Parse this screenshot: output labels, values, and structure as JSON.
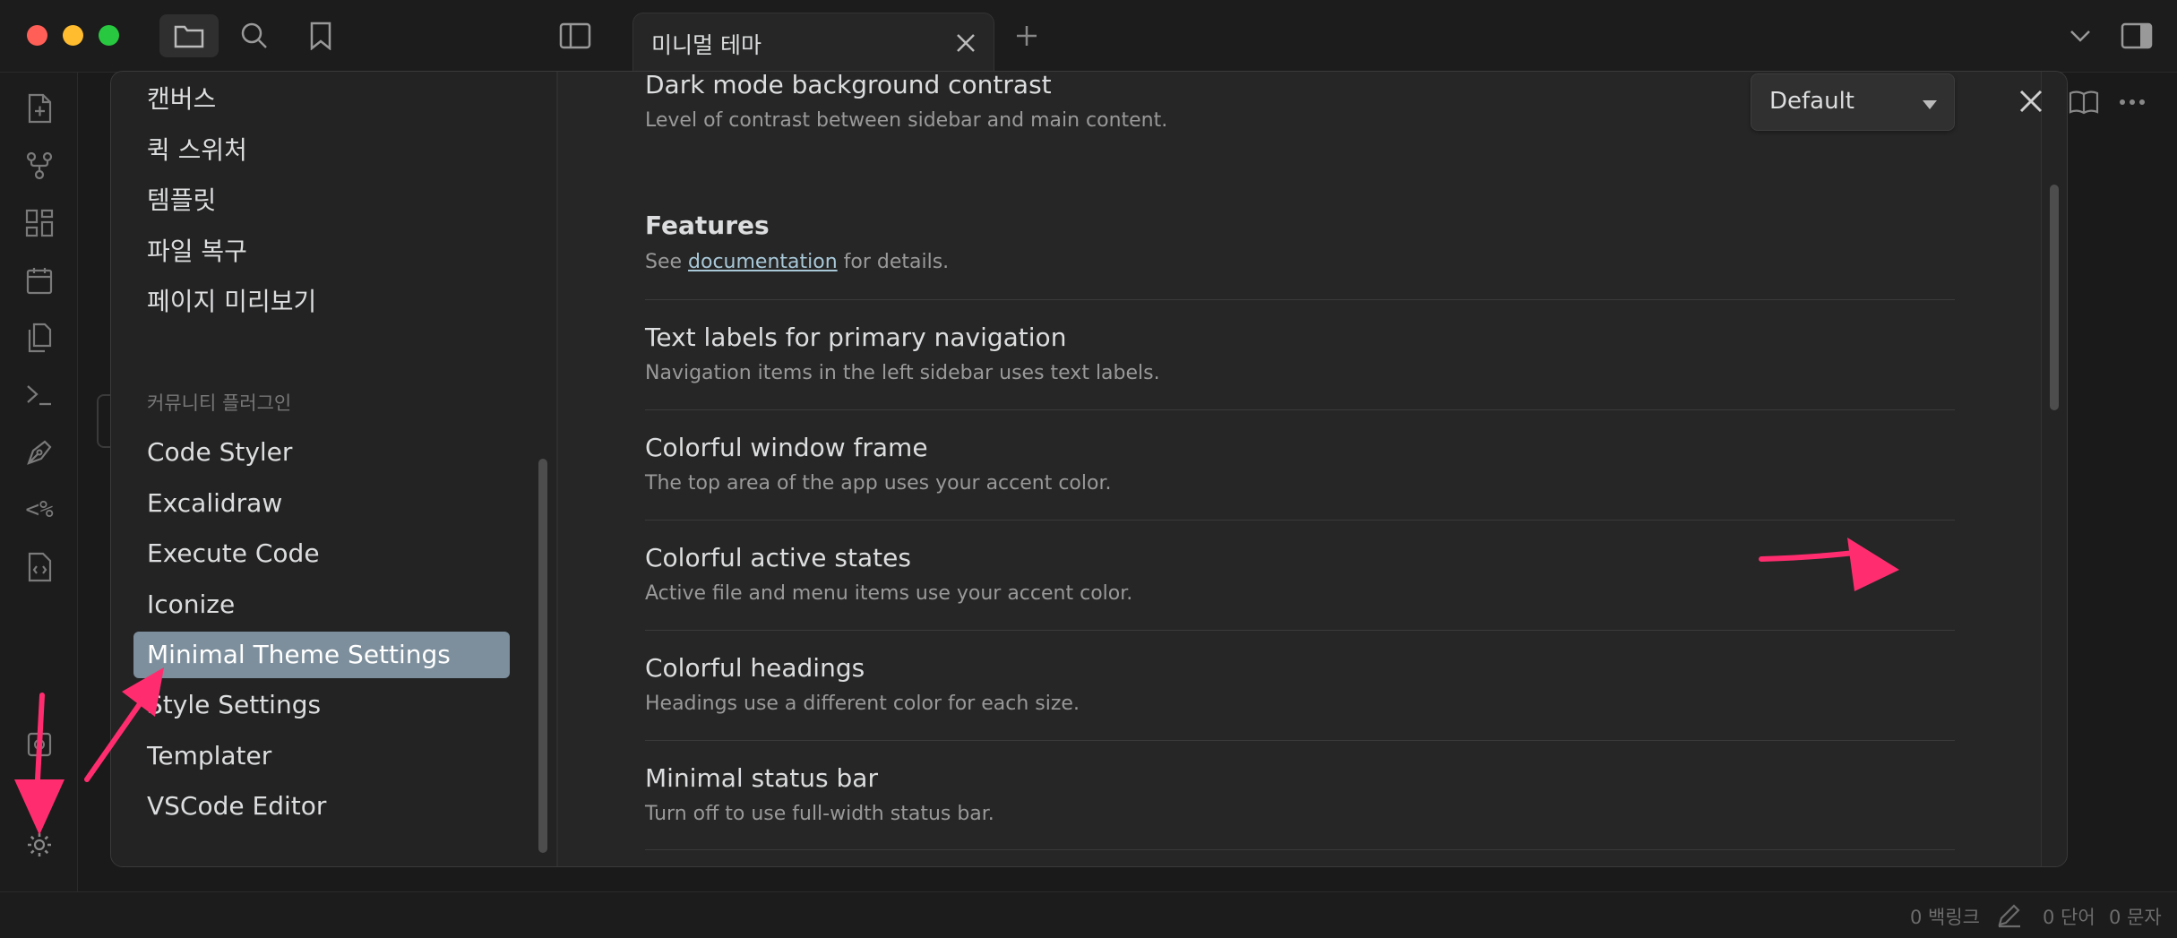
{
  "tab": {
    "title": "미니멀 테마"
  },
  "sidebar": {
    "core_items": [
      "캔버스",
      "퀵 스위처",
      "템플릿",
      "파일 복구",
      "페이지 미리보기"
    ],
    "community_heading": "커뮤니티 플러그인",
    "community_items": [
      "Code Styler",
      "Excalidraw",
      "Execute Code",
      "Iconize",
      "Minimal Theme Settings",
      "Style Settings",
      "Templater",
      "VSCode Editor"
    ],
    "active_item": "Minimal Theme Settings"
  },
  "settings": {
    "dark_contrast": {
      "name": "Dark mode background contrast",
      "desc": "Level of contrast between sidebar and main content.",
      "value": "Default"
    },
    "features": {
      "heading": "Features",
      "desc_prefix": "See ",
      "link": "documentation",
      "desc_suffix": " for details."
    },
    "toggles": [
      {
        "name": "Text labels for primary navigation",
        "desc": "Navigation items in the left sidebar uses text labels.",
        "on": false
      },
      {
        "name": "Colorful window frame",
        "desc": "The top area of the app uses your accent color.",
        "on": false
      },
      {
        "name": "Colorful active states",
        "desc": "Active file and menu items use your accent color.",
        "on": true
      },
      {
        "name": "Colorful headings",
        "desc": "Headings use a different color for each size.",
        "on": false
      },
      {
        "name": "Minimal status bar",
        "desc": "Turn off to use full-width status bar.",
        "on": false
      }
    ]
  },
  "statusbar": {
    "backlinks": "0 백링크",
    "words": "0 단어",
    "chars": "0 문자"
  },
  "colors": {
    "accent": "#7d8f9c",
    "annotation_arrow": "#ff2d6f",
    "toggle_on": "#6a7c89"
  }
}
